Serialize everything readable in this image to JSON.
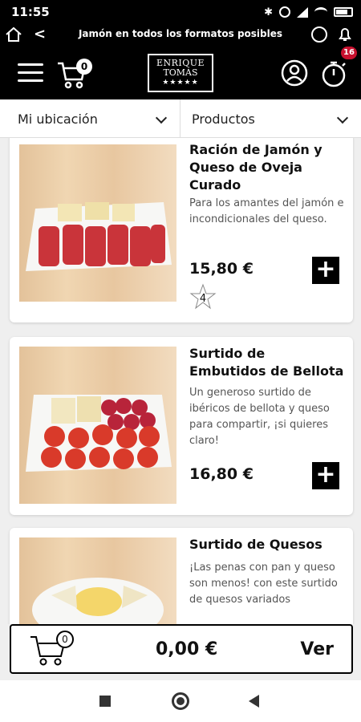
{
  "status_bar": {
    "time": "11:55",
    "battery_level": 0.8
  },
  "browser_bar": {
    "title": "Jamón en todos los formatos posibles"
  },
  "header": {
    "cart_count": "0",
    "logo_line1": "ENRIQUE",
    "logo_line2": "TOMÁS",
    "logo_stars": "★★★★★",
    "clock_badge": "16"
  },
  "filters": {
    "location_label": "Mi ubicación",
    "products_label": "Productos"
  },
  "products": [
    {
      "name": "Ración de Jamón y Queso de Oveja Curado",
      "description": "Para los amantes del jamón e incondicionales del queso.",
      "price": "15,80 €",
      "rating_count": "4",
      "add_label": "+"
    },
    {
      "name": "Surtido de Embutidos de Bellota",
      "description": "Un generoso surtido de ibéricos de bellota y queso para compartir, ¡si quieres claro!",
      "price": "16,80 €",
      "add_label": "+"
    },
    {
      "name": "Surtido de Quesos",
      "description": "¡Las penas con pan y queso son menos! con este surtido de quesos variados"
    }
  ],
  "cart_bar": {
    "count": "0",
    "total": "0,00 €",
    "view_label": "Ver"
  },
  "colors": {
    "header_bg": "#000000",
    "badge_red": "#c8102e",
    "page_bg": "#efefef"
  }
}
